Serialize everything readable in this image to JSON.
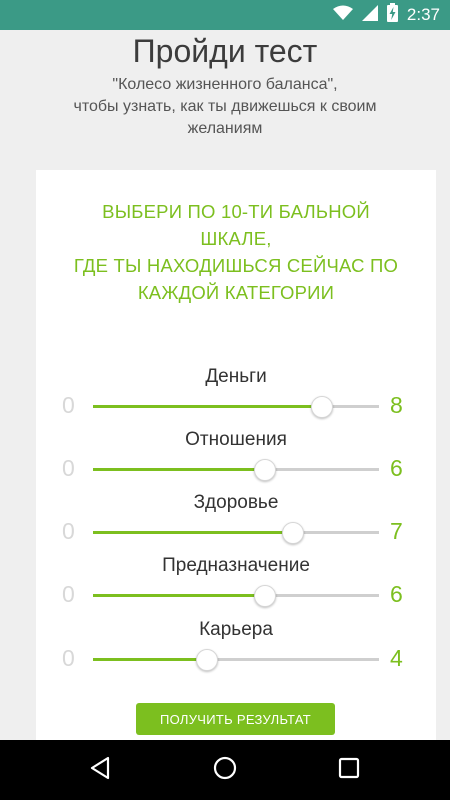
{
  "status_bar": {
    "time": "2:37",
    "icons": [
      "wifi-icon",
      "signal-icon",
      "battery-charging-icon"
    ],
    "color": "#3b9a86"
  },
  "header": {
    "title": "Пройди тест",
    "subtitle_line1": "\"Колесо жизненного баланса\",",
    "subtitle_line2": "чтобы узнать, как ты движешься к своим",
    "subtitle_line3": "желаниям"
  },
  "card": {
    "heading_line1": "ВЫБЕРИ ПО 10-ТИ БАЛЬНОЙ",
    "heading_line2": "ШКАЛЕ,",
    "heading_line3": "ГДЕ ТЫ НАХОДИШЬСЯ СЕЙЧАС ПО",
    "heading_line4": "КАЖДОЙ КАТЕГОРИИ",
    "accent_color": "#7cbf1f",
    "scale_max": 10,
    "categories": [
      {
        "label": "Деньги",
        "min": "0",
        "value": "8"
      },
      {
        "label": "Отношения",
        "min": "0",
        "value": "6"
      },
      {
        "label": "Здоровье",
        "min": "0",
        "value": "7"
      },
      {
        "label": "Предназначение",
        "min": "0",
        "value": "6"
      },
      {
        "label": "Карьера",
        "min": "0",
        "value": "4"
      }
    ],
    "button_label": "ПОЛУЧИТЬ РЕЗУЛЬТАТ"
  },
  "nav_bar": {
    "icons": [
      "back-icon",
      "home-icon",
      "recents-icon"
    ]
  }
}
